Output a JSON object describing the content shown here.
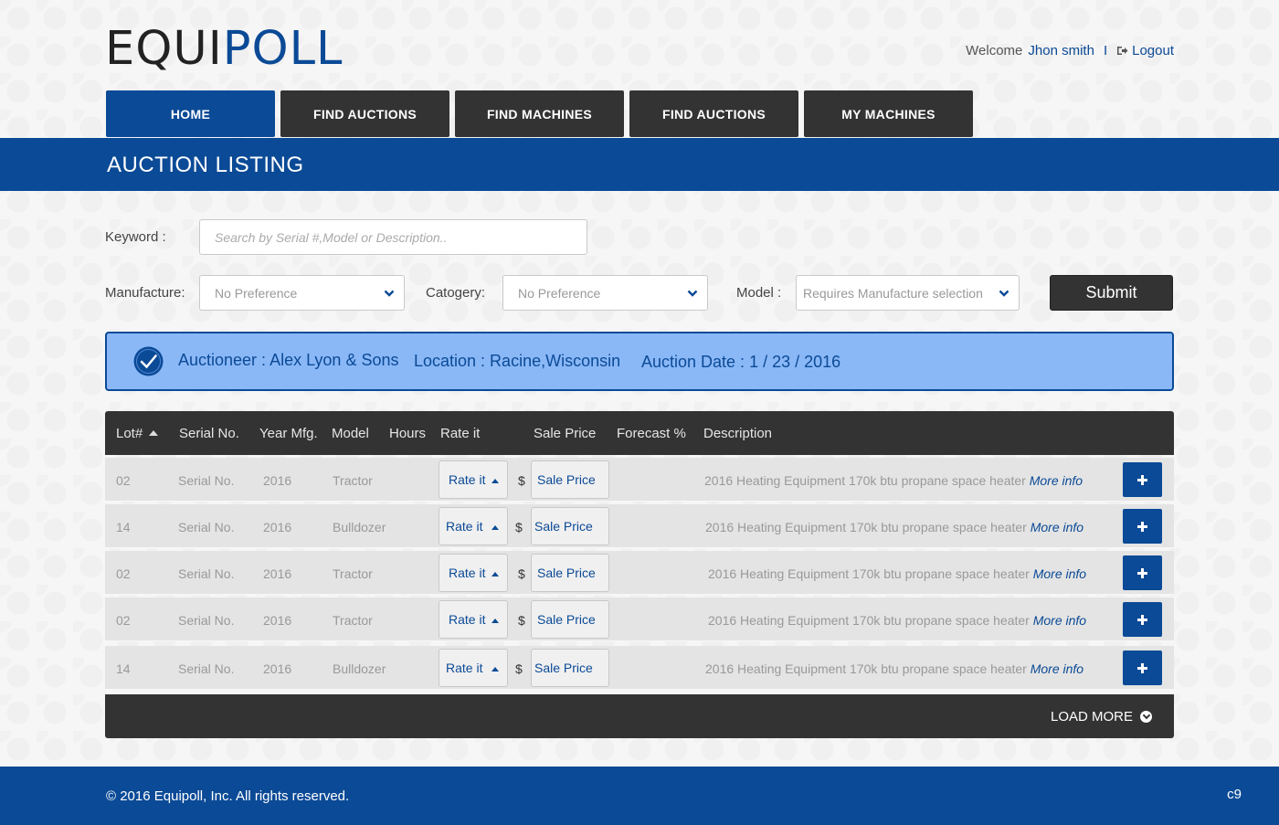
{
  "header": {
    "logo_part1": "EQUI",
    "logo_part2": "POLL",
    "welcome": "Welcome",
    "user_name": "Jhon smith",
    "separator": "I",
    "logout": "Logout"
  },
  "nav": [
    "HOME",
    "FIND AUCTIONS",
    "FIND MACHINES",
    "FIND AUCTIONS",
    "MY MACHINES"
  ],
  "page_title": "AUCTION LISTING",
  "filters": {
    "keyword_label": "Keyword :",
    "keyword_placeholder": "Search by Serial #,Model or Description..",
    "manufacture_label": "Manufacture:",
    "manufacture_value": "No Preference",
    "category_label": "Catogery:",
    "category_value": "No Preference",
    "model_label": "Model :",
    "model_value": "Requires Manufacture selection",
    "submit": "Submit"
  },
  "auction": {
    "auctioneer": "Auctioneer : Alex Lyon & Sons",
    "location": "Location : Racine,Wisconsin",
    "date": "Auction Date : 1 / 23 / 2016"
  },
  "table": {
    "headers": [
      "Lot#",
      "Serial No.",
      "Year Mfg.",
      "Model",
      "Hours",
      "Rate it",
      "Sale Price",
      "Forecast %",
      "Description"
    ],
    "rows": [
      {
        "lot": "02",
        "serial": "Serial No.",
        "year": "2016",
        "model": "Tractor",
        "rate": "Rate it",
        "dollar": "$",
        "price": "Sale Price",
        "desc": "2016 Heating Equipment 170k btu propane space heater",
        "more": "More info"
      },
      {
        "lot": "14",
        "serial": "Serial No.",
        "year": "2016",
        "model": "Bulldozer",
        "rate": "Rate it",
        "dollar": "$",
        "price": "Sale Price",
        "desc": "2016 Heating Equipment 170k btu propane space heater",
        "more": "More info"
      },
      {
        "lot": "02",
        "serial": "Serial No.",
        "year": "2016",
        "model": "Tractor",
        "rate": "Rate it",
        "dollar": "$",
        "price": "Sale Price",
        "desc": "2016 Heating Equipment 170k btu propane space heater",
        "more": "More info"
      },
      {
        "lot": "02",
        "serial": "Serial No.",
        "year": "2016",
        "model": "Tractor",
        "rate": "Rate it",
        "dollar": "$",
        "price": "Sale Price",
        "desc": "2016 Heating Equipment 170k btu propane space heater",
        "more": "More info"
      },
      {
        "lot": "14",
        "serial": "Serial No.",
        "year": "2016",
        "model": "Bulldozer",
        "rate": "Rate it",
        "dollar": "$",
        "price": "Sale Price",
        "desc": "2016 Heating Equipment 170k btu propane space heater",
        "more": "More info"
      }
    ],
    "load_more": "LOAD MORE"
  },
  "footer": {
    "copyright": "© 2016 Equipoll, Inc. All rights reserved.",
    "tag": "c9"
  },
  "colors": {
    "brand_blue": "#0b4a96",
    "banner_blue": "#8ab8f7",
    "dark": "#333333"
  },
  "icons": [
    "logout-icon",
    "chevron-down-icon",
    "check-circle-icon",
    "sort-up-icon",
    "plus-icon",
    "chevron-circle-down-icon"
  ]
}
